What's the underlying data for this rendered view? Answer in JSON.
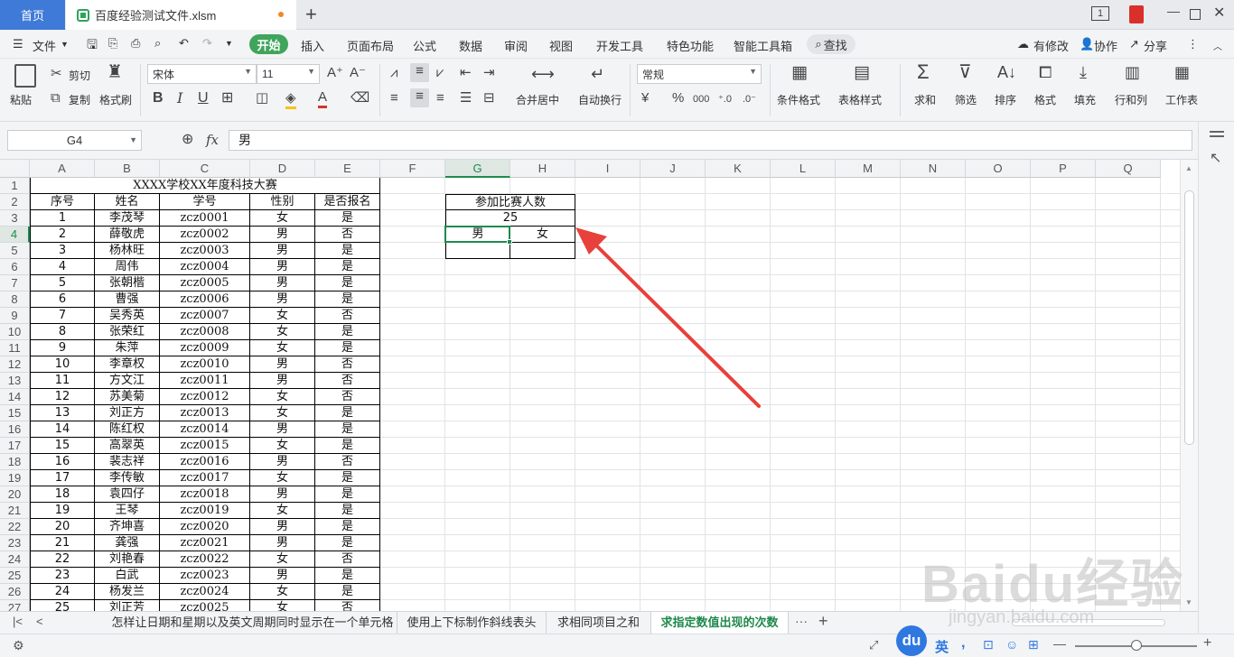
{
  "titlebar": {
    "home_tab": "首页",
    "file_tab": "百度经验测试文件.xlsm",
    "page_badge": "1"
  },
  "menu": {
    "file": "文件",
    "start": "开始",
    "items": [
      "插入",
      "页面布局",
      "公式",
      "数据",
      "审阅",
      "视图",
      "开发工具",
      "特色功能",
      "智能工具箱"
    ],
    "search": "查找",
    "right": [
      "有修改",
      "协作",
      "分享"
    ]
  },
  "ribbon": {
    "paste": "粘贴",
    "cut": "剪切",
    "copy": "复制",
    "format_painter": "格式刷",
    "font_name": "宋体",
    "font_size": "11",
    "merge_center": "合并居中",
    "wrap_text": "自动换行",
    "number_format": "常规",
    "cond_format": "条件格式",
    "table_style": "表格样式",
    "sum": "求和",
    "filter": "筛选",
    "sort": "排序",
    "format": "格式",
    "fill": "填充",
    "row_col": "行和列",
    "worksheet": "工作表"
  },
  "formula_bar": {
    "cell_ref": "G4",
    "value": "男"
  },
  "columns": [
    "A",
    "B",
    "C",
    "D",
    "E",
    "F",
    "G",
    "H",
    "I",
    "J",
    "K",
    "L",
    "M",
    "N",
    "O",
    "P",
    "Q"
  ],
  "rows": [
    "1",
    "2",
    "3",
    "4",
    "5",
    "6",
    "7",
    "8",
    "9",
    "10",
    "11",
    "12",
    "13",
    "14",
    "15",
    "16",
    "17",
    "18",
    "19",
    "20",
    "21",
    "22",
    "23",
    "24",
    "25",
    "26",
    "27"
  ],
  "table": {
    "title": "XXXX学校XX年度科技大赛",
    "headers": [
      "序号",
      "姓名",
      "学号",
      "性别",
      "是否报名"
    ],
    "records": [
      [
        "1",
        "李茂琴",
        "zcz0001",
        "女",
        "是"
      ],
      [
        "2",
        "薛敬虎",
        "zcz0002",
        "男",
        "否"
      ],
      [
        "3",
        "杨林旺",
        "zcz0003",
        "男",
        "是"
      ],
      [
        "4",
        "周伟",
        "zcz0004",
        "男",
        "是"
      ],
      [
        "5",
        "张朝楷",
        "zcz0005",
        "男",
        "是"
      ],
      [
        "6",
        "曹强",
        "zcz0006",
        "男",
        "是"
      ],
      [
        "7",
        "吴秀英",
        "zcz0007",
        "女",
        "否"
      ],
      [
        "8",
        "张荣红",
        "zcz0008",
        "女",
        "是"
      ],
      [
        "9",
        "朱萍",
        "zcz0009",
        "女",
        "是"
      ],
      [
        "10",
        "李章权",
        "zcz0010",
        "男",
        "否"
      ],
      [
        "11",
        "方文江",
        "zcz0011",
        "男",
        "否"
      ],
      [
        "12",
        "苏美菊",
        "zcz0012",
        "女",
        "否"
      ],
      [
        "13",
        "刘正方",
        "zcz0013",
        "女",
        "是"
      ],
      [
        "14",
        "陈红权",
        "zcz0014",
        "男",
        "是"
      ],
      [
        "15",
        "高翠英",
        "zcz0015",
        "女",
        "是"
      ],
      [
        "16",
        "裴志祥",
        "zcz0016",
        "男",
        "否"
      ],
      [
        "17",
        "李传敏",
        "zcz0017",
        "女",
        "是"
      ],
      [
        "18",
        "袁四仔",
        "zcz0018",
        "男",
        "是"
      ],
      [
        "19",
        "王琴",
        "zcz0019",
        "女",
        "是"
      ],
      [
        "20",
        "齐坤喜",
        "zcz0020",
        "男",
        "是"
      ],
      [
        "21",
        "龚强",
        "zcz0021",
        "男",
        "是"
      ],
      [
        "22",
        "刘艳春",
        "zcz0022",
        "女",
        "否"
      ],
      [
        "23",
        "白武",
        "zcz0023",
        "男",
        "是"
      ],
      [
        "24",
        "杨发兰",
        "zcz0024",
        "女",
        "是"
      ],
      [
        "25",
        "刘正芳",
        "zcz0025",
        "女",
        "否"
      ]
    ]
  },
  "summary": {
    "title": "参加比赛人数",
    "total": "25",
    "male": "男",
    "female": "女"
  },
  "sheet_tabs": [
    "怎样让日期和星期以及英文周期同时显示在一个单元格",
    "使用上下标制作斜线表头",
    "求相同项目之和",
    "求指定数值出现的次数"
  ],
  "sheet_tabs_more": "···",
  "status": {
    "ime_lang": "英",
    "watermark": "Baidu经验",
    "watermark_url": "jingyan.baidu.com"
  },
  "colors": {
    "accent": "#3fa55b",
    "arrow": "#e8403b",
    "home_tab": "#3f7ad8"
  }
}
